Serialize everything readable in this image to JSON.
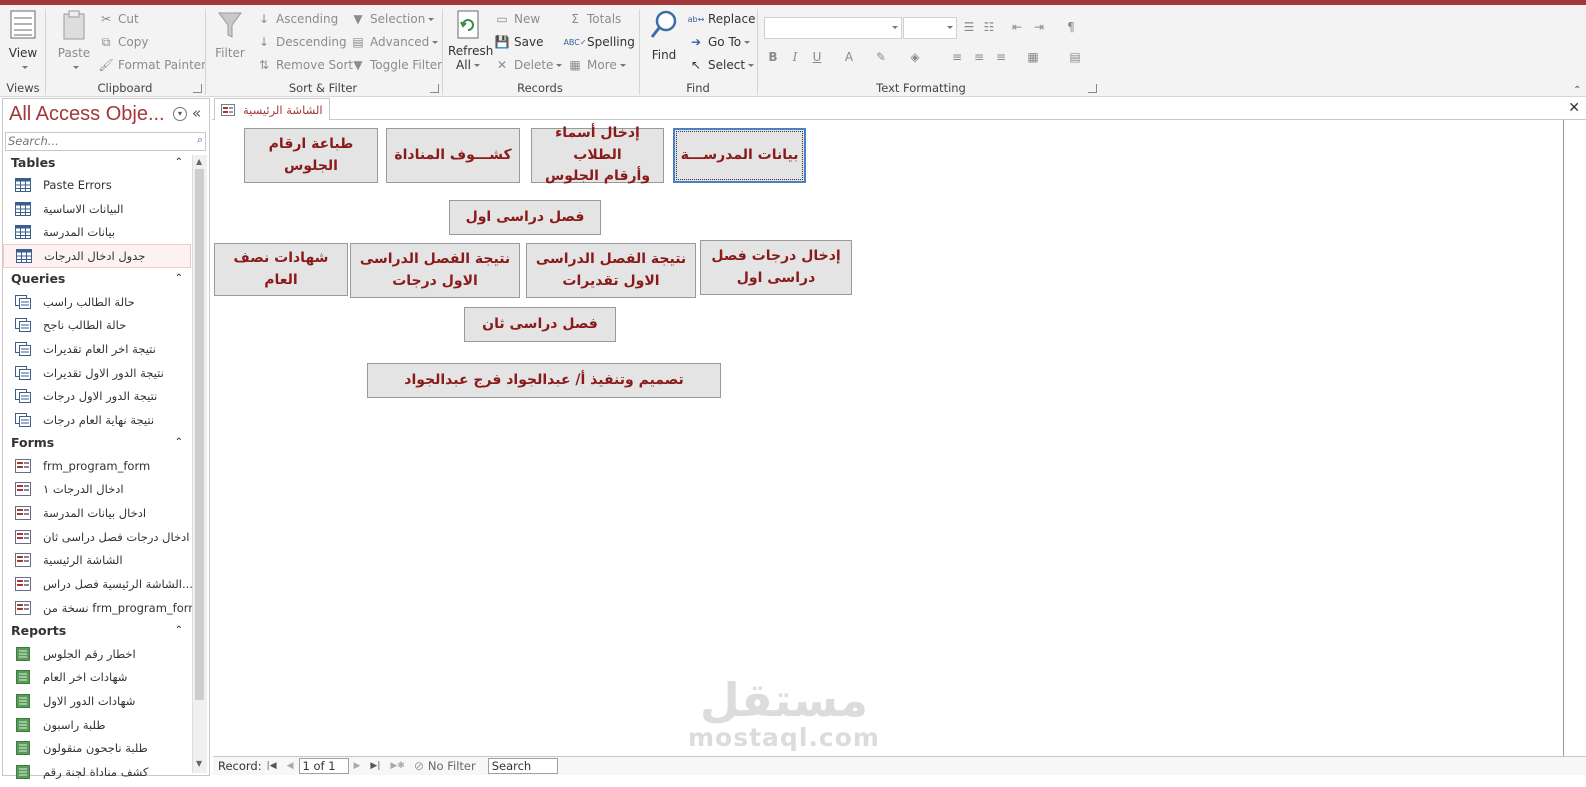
{
  "ribbon": {
    "views": {
      "view_label": "View",
      "group_label": "Views"
    },
    "clipboard": {
      "paste_label": "Paste",
      "cut_label": "Cut",
      "copy_label": "Copy",
      "format_painter_label": "Format Painter",
      "group_label": "Clipboard"
    },
    "sort_filter": {
      "filter_label": "Filter",
      "ascending_label": "Ascending",
      "descending_label": "Descending",
      "remove_sort_label": "Remove Sort",
      "selection_label": "Selection",
      "advanced_label": "Advanced",
      "toggle_filter_label": "Toggle Filter",
      "group_label": "Sort & Filter"
    },
    "records": {
      "refresh_label_1": "Refresh",
      "refresh_label_2": "All",
      "new_label": "New",
      "save_label": "Save",
      "delete_label": "Delete",
      "totals_label": "Totals",
      "spelling_label": "Spelling",
      "more_label": "More",
      "group_label": "Records"
    },
    "find": {
      "find_label": "Find",
      "replace_label": "Replace",
      "goto_label": "Go To",
      "select_label": "Select",
      "group_label": "Find"
    },
    "text_formatting": {
      "group_label": "Text Formatting",
      "bold": "B",
      "italic": "I",
      "underline": "U",
      "font_color": "A"
    }
  },
  "nav": {
    "title": "All Access Obje...",
    "search_placeholder": "Search...",
    "categories": [
      {
        "name": "Tables",
        "items": [
          "Paste Errors",
          "البيانات الاساسية",
          "بيانات المدرسة",
          "جدول ادخال الدرجات"
        ]
      },
      {
        "name": "Queries",
        "items": [
          "حالة الطالب راسب",
          "حالة الطالب ناجح",
          "نتيجة اخر العام تقديرات",
          "نتيجة الدور الاول تقديرات",
          "نتيجة الدور الاول درجات",
          "نتيجة نهاية العام  درجات"
        ]
      },
      {
        "name": "Forms",
        "items": [
          "frm_program_form",
          "ادخال الدرجات ١",
          "ادخال بيانات المدرسة",
          "ادخال درجات فصل دراسى ثان",
          "الشاشة  الرئيسية",
          "الشاشة  الرئيسية فصل دراس...",
          "نسخة من  frm_program_form"
        ]
      },
      {
        "name": "Reports",
        "items": [
          "اخطار رقم الجلوس",
          "شهادات اخر العام",
          "شهادات الدور الاول",
          "طلبة راسبون",
          "طلبة ناجحون منقولون",
          "كشف مناداة لجنة رقم"
        ]
      }
    ]
  },
  "document": {
    "tab_title": "الشاشة  الرئيسية",
    "buttons": {
      "school_data": "بيانات المدرســـة",
      "enter_names_line1": "إدخال أسماء الطلاب",
      "enter_names_line2": "وأرقام الجلوس",
      "roll_call": "كشـــوف المناداة",
      "print_seats": "طباعة ارقام الجلوس",
      "term1_heading": "فصل دراسى اول",
      "enter_grades_line1": "إدخال درجات  فصل",
      "enter_grades_line2": "دراسى اول",
      "result_grades_line1": "نتيجة الفصل الدراسى",
      "result_grades_line2": "الاول تقديرات",
      "result_marks_line1": "نتيجة الفصل الدراسى",
      "result_marks_line2": "الاول درجات",
      "midyear_certificates": "شهادات نصف العام",
      "term2_heading": "فصل دراسى ثان",
      "credits": "تصميم وتنفيذ أ/ عبدالجواد فرج عبدالجواد"
    },
    "watermark": {
      "arabic": "مستقل",
      "latin": "mostaql.com"
    },
    "record_nav": {
      "record_label": "Record:",
      "position": "1 of 1",
      "filter_label": "No Filter",
      "search_label": "Search"
    }
  },
  "colors": {
    "accent": "#a4373a",
    "button_text": "#8b1a1a",
    "button_face": "#e4e4e4"
  }
}
